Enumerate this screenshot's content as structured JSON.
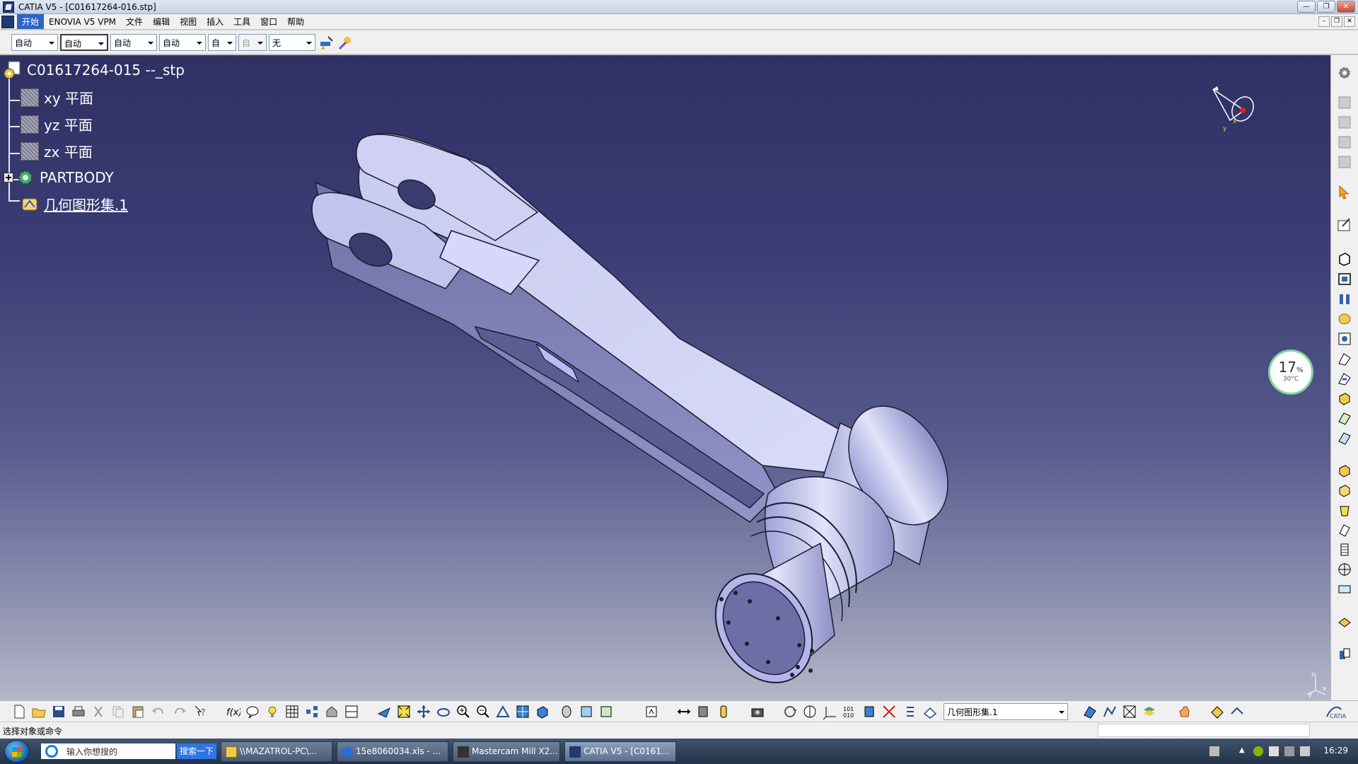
{
  "window": {
    "title": "CATIA V5 - [C01617264-016.stp]",
    "minimize": "—",
    "restore": "❐",
    "close": "✕"
  },
  "menu": {
    "items": [
      "开始",
      "ENOVIA V5 VPM",
      "文件",
      "编辑",
      "视图",
      "插入",
      "工具",
      "窗口",
      "帮助"
    ]
  },
  "toolbar_top": {
    "combos": [
      "自动",
      "自动",
      "自动",
      "自动",
      "自动",
      "自动",
      "无"
    ]
  },
  "tree": {
    "root": "C01617264-015 --_stp",
    "nodes": [
      "xy 平面",
      "yz 平面",
      "zx 平面",
      "PARTBODY",
      "几何图形集.1"
    ]
  },
  "widget": {
    "percent": "17",
    "percent_unit": "%",
    "temp": "30°C"
  },
  "compass": {
    "x": "x",
    "y": "y",
    "z": "z"
  },
  "axis_triad": {
    "z": "z",
    "y": "y",
    "x": "x"
  },
  "bottom_toolbar": {
    "combo_value": "几何图形集.1"
  },
  "statusbar": {
    "prompt": "选择对象或命令"
  },
  "taskbar": {
    "search_placeholder": "输入你想搜的",
    "search_button": "搜索一下",
    "tasks": [
      "\\\\MAZATROL-PC\\...",
      "15e8060034.xls - ...",
      "Mastercam Mill X2...",
      "CATIA V5 - [C0161..."
    ],
    "clock": "16:29"
  },
  "colors": {
    "viewport_top": "#2f3064",
    "viewport_bottom": "#b6b6c8",
    "part_face": "#c8c9ef",
    "part_edge": "#1b1c2e"
  }
}
